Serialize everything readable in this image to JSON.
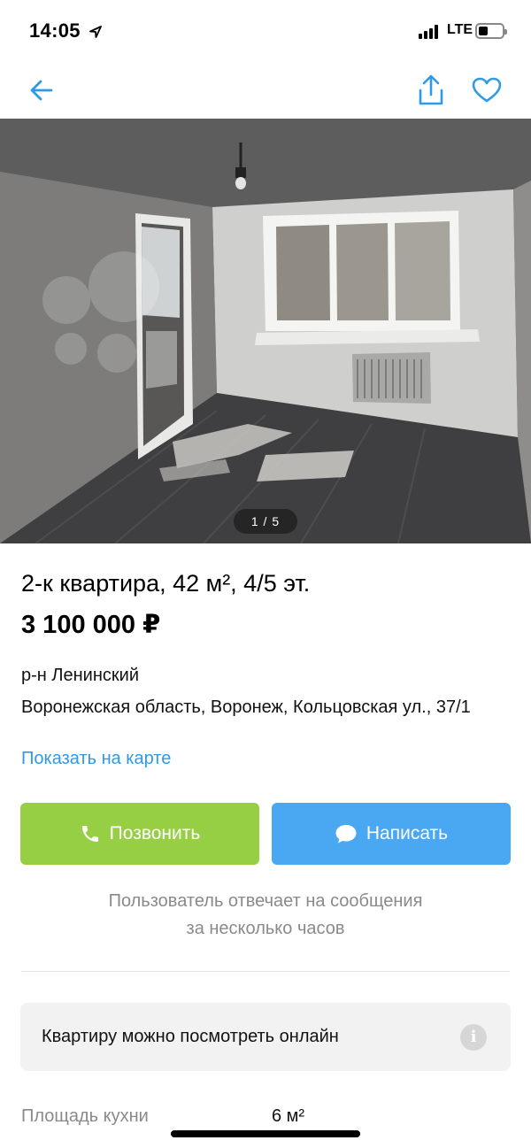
{
  "status_bar": {
    "time": "14:05",
    "network": "LTE",
    "location_icon": "location-arrow-icon"
  },
  "nav": {
    "back_icon": "arrow-left-icon",
    "share_icon": "share-icon",
    "favorite_icon": "heart-icon",
    "accent_color": "#2f9ae6"
  },
  "photo": {
    "counter": "1 / 5",
    "current": 1,
    "total": 5
  },
  "listing": {
    "title": "2-к квартира, 42 м², 4/5 эт.",
    "price": "3 100 000 ₽",
    "district": "р-н Ленинский",
    "address": "Воронежская область, Воронеж, Кольцовская ул., 37/1",
    "map_link": "Показать на карте"
  },
  "actions": {
    "call_label": "Позвонить",
    "call_color": "#97cf44",
    "message_label": "Написать",
    "message_color": "#4aa8f2"
  },
  "reply_note": {
    "line1": "Пользователь отвечает на сообщения",
    "line2": "за несколько часов"
  },
  "online_view": {
    "text": "Квартиру можно посмотреть онлайн",
    "icon": "info-icon"
  },
  "params": [
    {
      "label": "Площадь кухни",
      "value": "6 м²"
    }
  ]
}
